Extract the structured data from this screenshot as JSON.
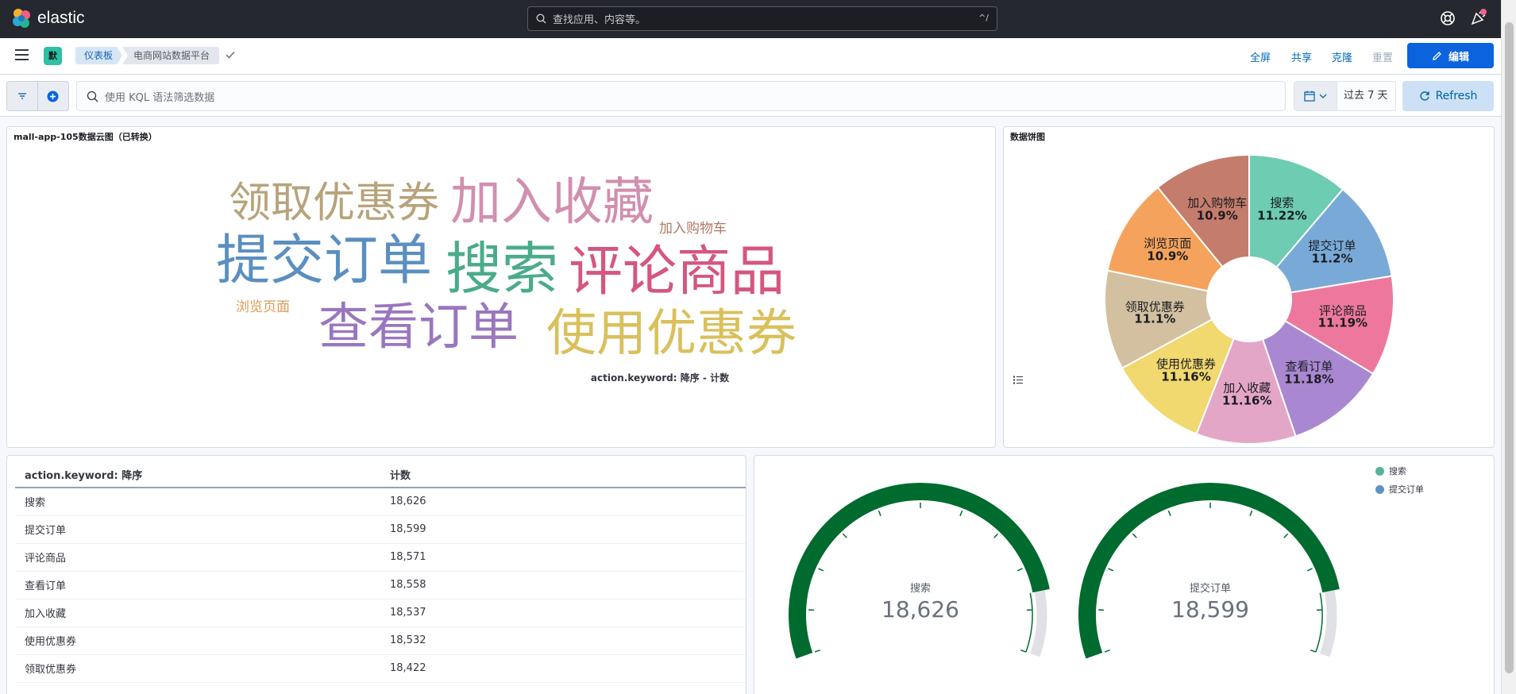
{
  "header": {
    "brand": "elastic",
    "search_placeholder": "查找应用、内容等。",
    "search_shortcut": "^/"
  },
  "nav": {
    "space_initial": "默",
    "breadcrumbs": [
      "仪表板",
      "电商网站数据平台"
    ],
    "actions": {
      "fullscreen": "全屏",
      "share": "共享",
      "clone": "克隆",
      "reset": "重置",
      "edit": "编辑"
    }
  },
  "query": {
    "placeholder": "使用 KQL 语法筛选数据",
    "time_range": "过去 7 天",
    "refresh": "Refresh"
  },
  "wordcloud": {
    "title": "mall-app-105数据云图（已转换）",
    "footer": "action.keyword: 降序 - 计数",
    "words": [
      {
        "text": "领取优惠券",
        "color": "#b7a37b"
      },
      {
        "text": "加入收藏",
        "color": "#d18fb0"
      },
      {
        "text": "加入购物车",
        "color": "#b07a66"
      },
      {
        "text": "提交订单",
        "color": "#5a8fc0"
      },
      {
        "text": "搜索",
        "color": "#4aab8b"
      },
      {
        "text": "评论商品",
        "color": "#d5567e"
      },
      {
        "text": "浏览页面",
        "color": "#d99b57"
      },
      {
        "text": "查看订单",
        "color": "#9a76c0"
      },
      {
        "text": "使用优惠券",
        "color": "#d9c05b"
      }
    ]
  },
  "pie": {
    "title": "数据饼图",
    "slices": [
      {
        "label": "搜索",
        "pct": "11.22%",
        "value": 11.22,
        "color": "#6dccb1"
      },
      {
        "label": "提交订单",
        "pct": "11.2%",
        "value": 11.2,
        "color": "#79aad7"
      },
      {
        "label": "评论商品",
        "pct": "11.19%",
        "value": 11.19,
        "color": "#ee789d"
      },
      {
        "label": "查看订单",
        "pct": "11.18%",
        "value": 11.18,
        "color": "#a987d1"
      },
      {
        "label": "加入收藏",
        "pct": "11.16%",
        "value": 11.16,
        "color": "#e4a6c7"
      },
      {
        "label": "使用优惠券",
        "pct": "11.16%",
        "value": 11.16,
        "color": "#f1d86f"
      },
      {
        "label": "领取优惠券",
        "pct": "11.1%",
        "value": 11.1,
        "color": "#d2c0a0"
      },
      {
        "label": "浏览页面",
        "pct": "10.9%",
        "value": 10.9,
        "color": "#f5a35c"
      },
      {
        "label": "加入购物车",
        "pct": "10.9%",
        "value": 10.9,
        "color": "#c47c6c"
      }
    ]
  },
  "table": {
    "headers": [
      "action.keyword: 降序",
      "计数"
    ],
    "rows": [
      [
        "搜索",
        "18,626"
      ],
      [
        "提交订单",
        "18,599"
      ],
      [
        "评论商品",
        "18,571"
      ],
      [
        "查看订单",
        "18,558"
      ],
      [
        "加入收藏",
        "18,537"
      ],
      [
        "使用优惠券",
        "18,532"
      ],
      [
        "领取优惠券",
        "18,422"
      ]
    ]
  },
  "gauges": {
    "legend": [
      {
        "label": "搜索",
        "color": "#54b399"
      },
      {
        "label": "提交订单",
        "color": "#6092c0"
      }
    ],
    "items": [
      {
        "name": "搜索",
        "value": "18,626",
        "fraction": 0.86
      },
      {
        "name": "提交订单",
        "value": "18,599",
        "fraction": 0.86
      }
    ],
    "fill_color": "#006b2e",
    "track_color": "#dfe1e5"
  }
}
